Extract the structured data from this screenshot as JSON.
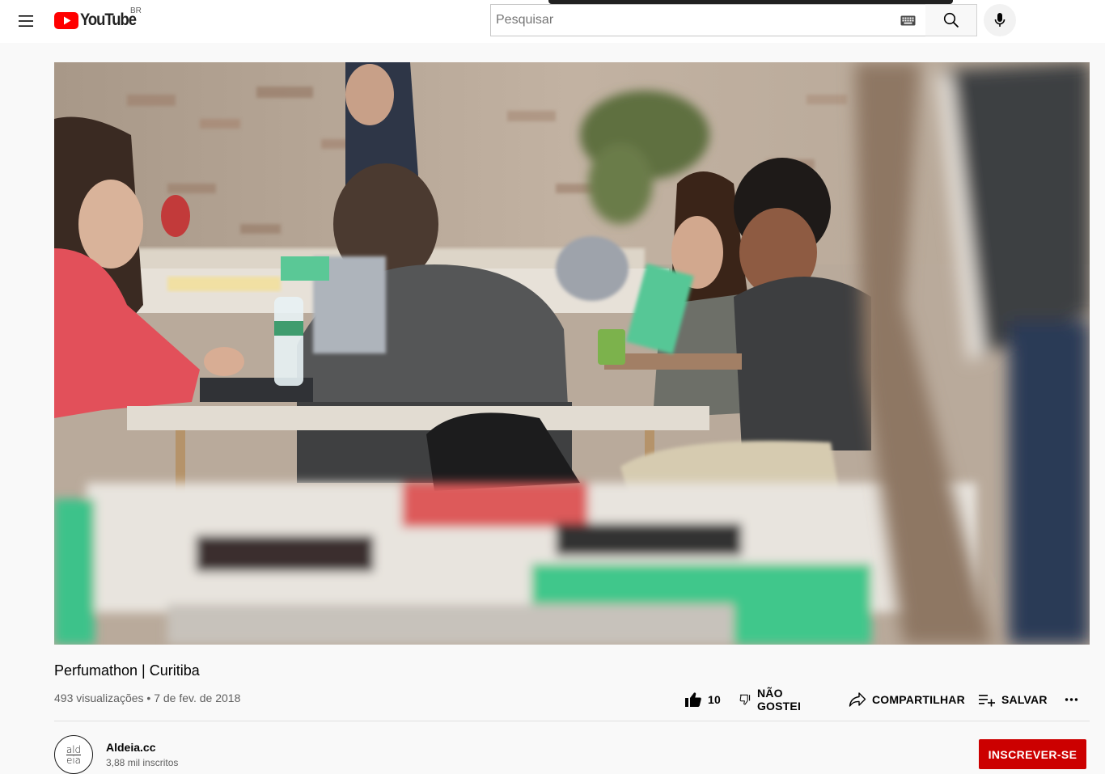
{
  "masthead": {
    "logo_text": "YouTube",
    "country_code": "BR",
    "search_placeholder": "Pesquisar",
    "icons": {
      "menu": "hamburger-menu-icon",
      "logo": "youtube-play-icon",
      "keyboard": "keyboard-icon",
      "search": "search-icon",
      "mic": "microphone-icon"
    }
  },
  "video": {
    "title": "Perfumathon | Curitiba",
    "views": "493 visualizações",
    "date_separator": "•",
    "date": "7 de fev. de 2018"
  },
  "actions": {
    "like_count": "10",
    "dislike_label": "NÃO GOSTEI",
    "share_label": "COMPARTILHAR",
    "save_label": "SALVAR",
    "icons": {
      "like": "thumbs-up-icon",
      "dislike": "thumbs-down-icon",
      "share": "share-arrow-icon",
      "save": "playlist-add-icon",
      "more": "more-horiz-icon"
    }
  },
  "channel": {
    "name": "Aldeia.cc",
    "subscribers": "3,88 mil inscritos",
    "avatar_top": "ald",
    "avatar_bottom": "eia",
    "subscribe_label": "INSCREVER-SE"
  },
  "colors": {
    "brand_red": "#ff0000",
    "subscribe_red": "#cc0000",
    "background": "#f9f9f9",
    "text_primary": "#030303",
    "text_secondary": "#606060"
  }
}
